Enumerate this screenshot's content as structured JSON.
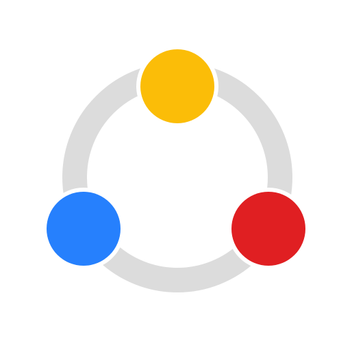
{
  "icon": {
    "name": "share-network-logo",
    "ring_color": "#dcdcdc",
    "gap_color": "#ffffff",
    "nodes": [
      {
        "name": "yellow-node",
        "color": "#fbbd08"
      },
      {
        "name": "blue-node",
        "color": "#2680fd"
      },
      {
        "name": "red-node",
        "color": "#e01f22"
      }
    ]
  }
}
